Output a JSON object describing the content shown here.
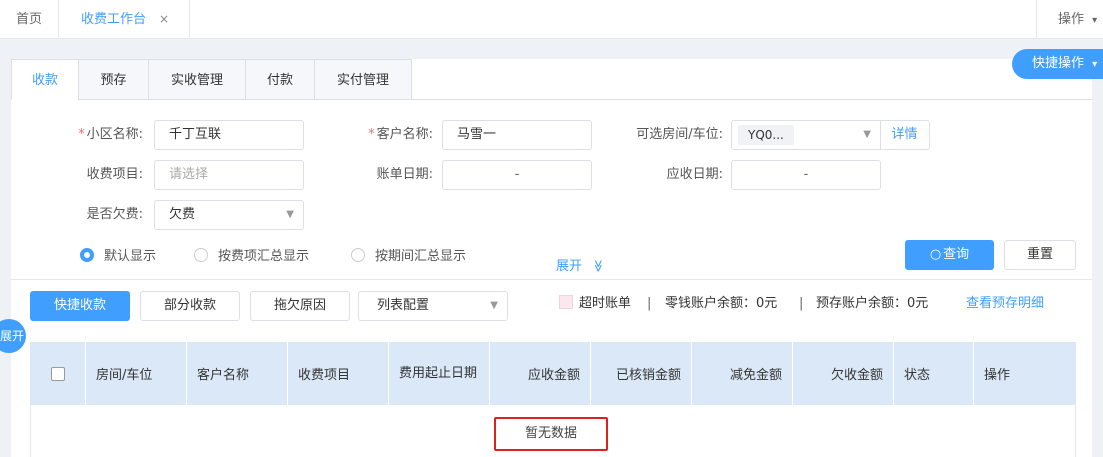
{
  "topbar": {
    "home_tab": "首页",
    "current_tab": "收费工作台",
    "close_symbol": "×",
    "ops_label": "操作",
    "ops_caret": "▾"
  },
  "quick_operation": {
    "label": "快捷操作",
    "caret": "▾"
  },
  "side_toggle": {
    "label": "展开"
  },
  "subtabs": [
    "收款",
    "预存",
    "实收管理",
    "付款",
    "实付管理"
  ],
  "form": {
    "community": {
      "label": "小区名称:",
      "required": "*",
      "value": "千丁互联"
    },
    "customer": {
      "label": "客户名称:",
      "required": "*",
      "value": "马雪一"
    },
    "room": {
      "label": "可选房间/车位:",
      "chip": "YQ0...",
      "detail": "详情"
    },
    "charge_item": {
      "label": "收费项目:",
      "placeholder": "请选择"
    },
    "bill_date": {
      "label": "账单日期:",
      "separator": "-"
    },
    "due_date": {
      "label": "应收日期:",
      "separator": "-"
    },
    "arrears": {
      "label": "是否欠费:",
      "value": "欠费"
    }
  },
  "display_modes": [
    {
      "label": "默认显示",
      "selected": true
    },
    {
      "label": "按费项汇总显示",
      "selected": false
    },
    {
      "label": "按期间汇总显示",
      "selected": false
    }
  ],
  "expand": {
    "label": "展开",
    "icon": "≫"
  },
  "query": {
    "icon": "○",
    "label": "查询",
    "reset": "重置"
  },
  "actions": {
    "quick_collect": "快捷收款",
    "partial_collect": "部分收款",
    "arrears_reason": "拖欠原因",
    "list_config": "列表配置",
    "list_config_caret": "▾"
  },
  "info": {
    "overdue_label": "超时账单",
    "sep": "|",
    "change_balance": "零钱账户余额：0元",
    "prepaid_balance": "预存账户余额：0元",
    "view_prepaid": "查看预存明细"
  },
  "table": {
    "headers": [
      "房间/车位",
      "客户名称",
      "收费项目",
      "费用起止日期",
      "应收金额",
      "已核销金额",
      "减免金额",
      "欠收金额",
      "状态",
      "操作"
    ],
    "empty_text": "暂无数据"
  },
  "colors": {
    "accent": "#409eff",
    "header_bg": "#dbe8f7",
    "highlight_border": "#e0201c"
  }
}
